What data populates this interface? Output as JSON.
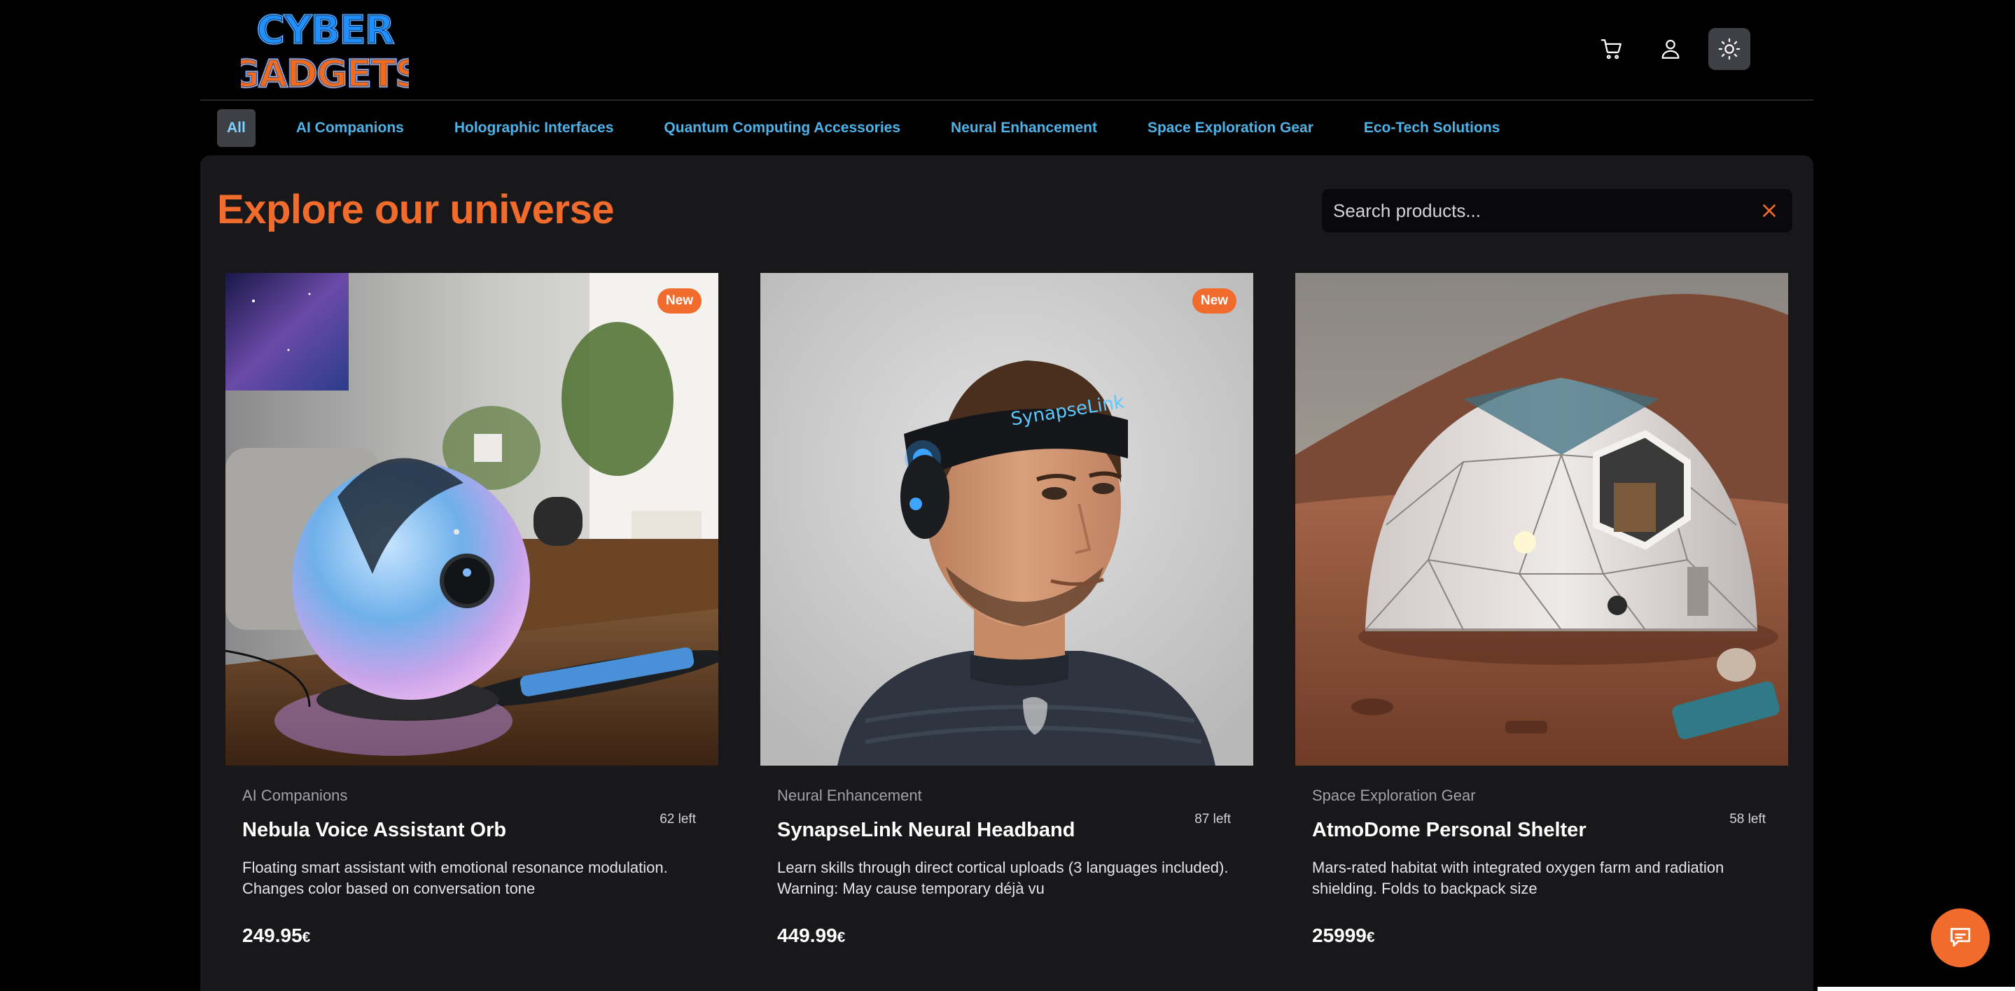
{
  "header": {
    "logo": {
      "line1": "CYBER",
      "line2": "GADGETS"
    },
    "icons": [
      "cart-icon",
      "user-icon",
      "sun-icon"
    ]
  },
  "nav": {
    "items": [
      {
        "label": "All",
        "active": true
      },
      {
        "label": "AI Companions",
        "active": false
      },
      {
        "label": "Holographic Interfaces",
        "active": false
      },
      {
        "label": "Quantum Computing Accessories",
        "active": false
      },
      {
        "label": "Neural Enhancement",
        "active": false
      },
      {
        "label": "Space Exploration Gear",
        "active": false
      },
      {
        "label": "Eco-Tech Solutions",
        "active": false
      }
    ]
  },
  "main": {
    "title": "Explore our universe",
    "search": {
      "placeholder": "Search products...",
      "value": ""
    }
  },
  "products": [
    {
      "badge": "New",
      "category": "AI Companions",
      "stock": "62 left",
      "name": "Nebula Voice Assistant Orb",
      "description": "Floating smart assistant with emotional resonance modulation. Changes color based on conversation tone",
      "price": "249.95",
      "currency": "€"
    },
    {
      "badge": "New",
      "category": "Neural Enhancement",
      "stock": "87 left",
      "name": "SynapseLink Neural Headband",
      "description": "Learn skills through direct cortical uploads (3 languages included). Warning: May cause temporary déjà vu",
      "price": "449.99",
      "currency": "€",
      "headband_text": "SynapseLink"
    },
    {
      "badge": "",
      "category": "Space Exploration Gear",
      "stock": "58 left",
      "name": "AtmoDome Personal Shelter",
      "description": "Mars-rated habitat with integrated oxygen farm and radiation shielding. Folds to backpack size",
      "price": "25999",
      "currency": "€"
    }
  ],
  "colors": {
    "accent": "#f06b2c",
    "nav_link": "#4fb3e8",
    "panel": "#18181b",
    "background": "#000000"
  },
  "chat": {
    "icon": "chat-icon"
  }
}
